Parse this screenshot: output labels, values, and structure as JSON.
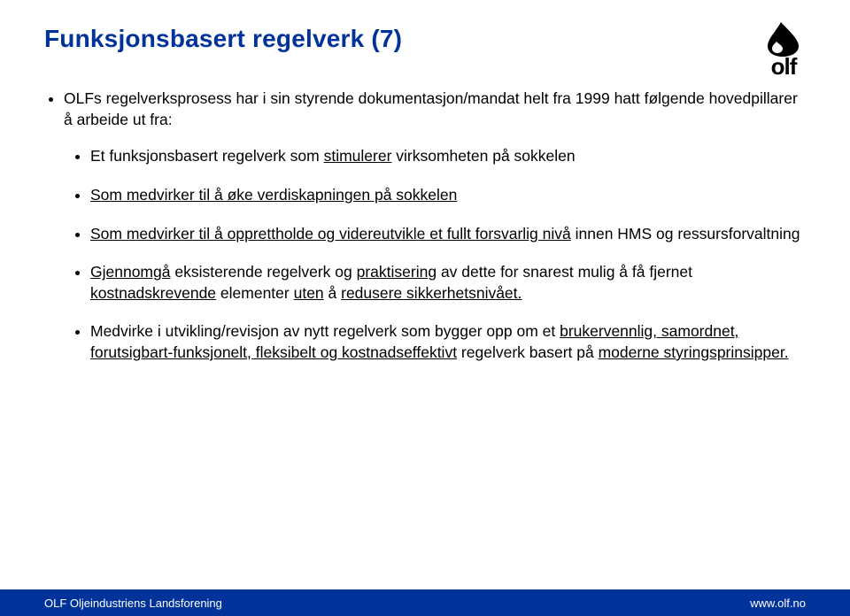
{
  "title": "Funksjonsbasert regelverk (7)",
  "logo": {
    "text": "olf"
  },
  "intro": "OLFs regelverksprosess har i sin styrende dokumentasjon/mandat helt fra 1999 hatt følgende hovedpillarer å arbeide ut fra:",
  "sub": {
    "0": {
      "pre": "Et funksjonsbasert regelverk som ",
      "u1": "stimulerer",
      "post": " virksomheten på sokkelen"
    },
    "1": {
      "u1": "Som medvirker til å øke verdiskapningen på sokkelen"
    },
    "2": {
      "u1": "Som medvirker til å opprettholde og videreutvikle et fullt forsvarlig nivå",
      "post": " innen HMS og ressursforvaltning"
    },
    "3": {
      "u1": "Gjennomgå",
      "t1": " eksisterende regelverk og ",
      "u2": "praktisering",
      "t2": " av dette for snarest mulig å få fjernet ",
      "u3": "kostnadskrevende",
      "t3": " elementer ",
      "u4": "uten",
      "t4": " å ",
      "u5": "redusere sikkerhetsnivået.",
      "t5": ""
    },
    "4": {
      "t0": "Medvirke i utvikling/revisjon av nytt regelverk som bygger opp om et ",
      "u1": "brukervennlig, samordnet, forutsigbart-funksjonelt, fleksibelt og kostnadseffektivt",
      "t1": " regelverk basert på ",
      "u2": "moderne styringsprinsipper.",
      "t2": ""
    }
  },
  "footer": {
    "left": "OLF Oljeindustriens Landsforening",
    "right": "www.olf.no"
  }
}
